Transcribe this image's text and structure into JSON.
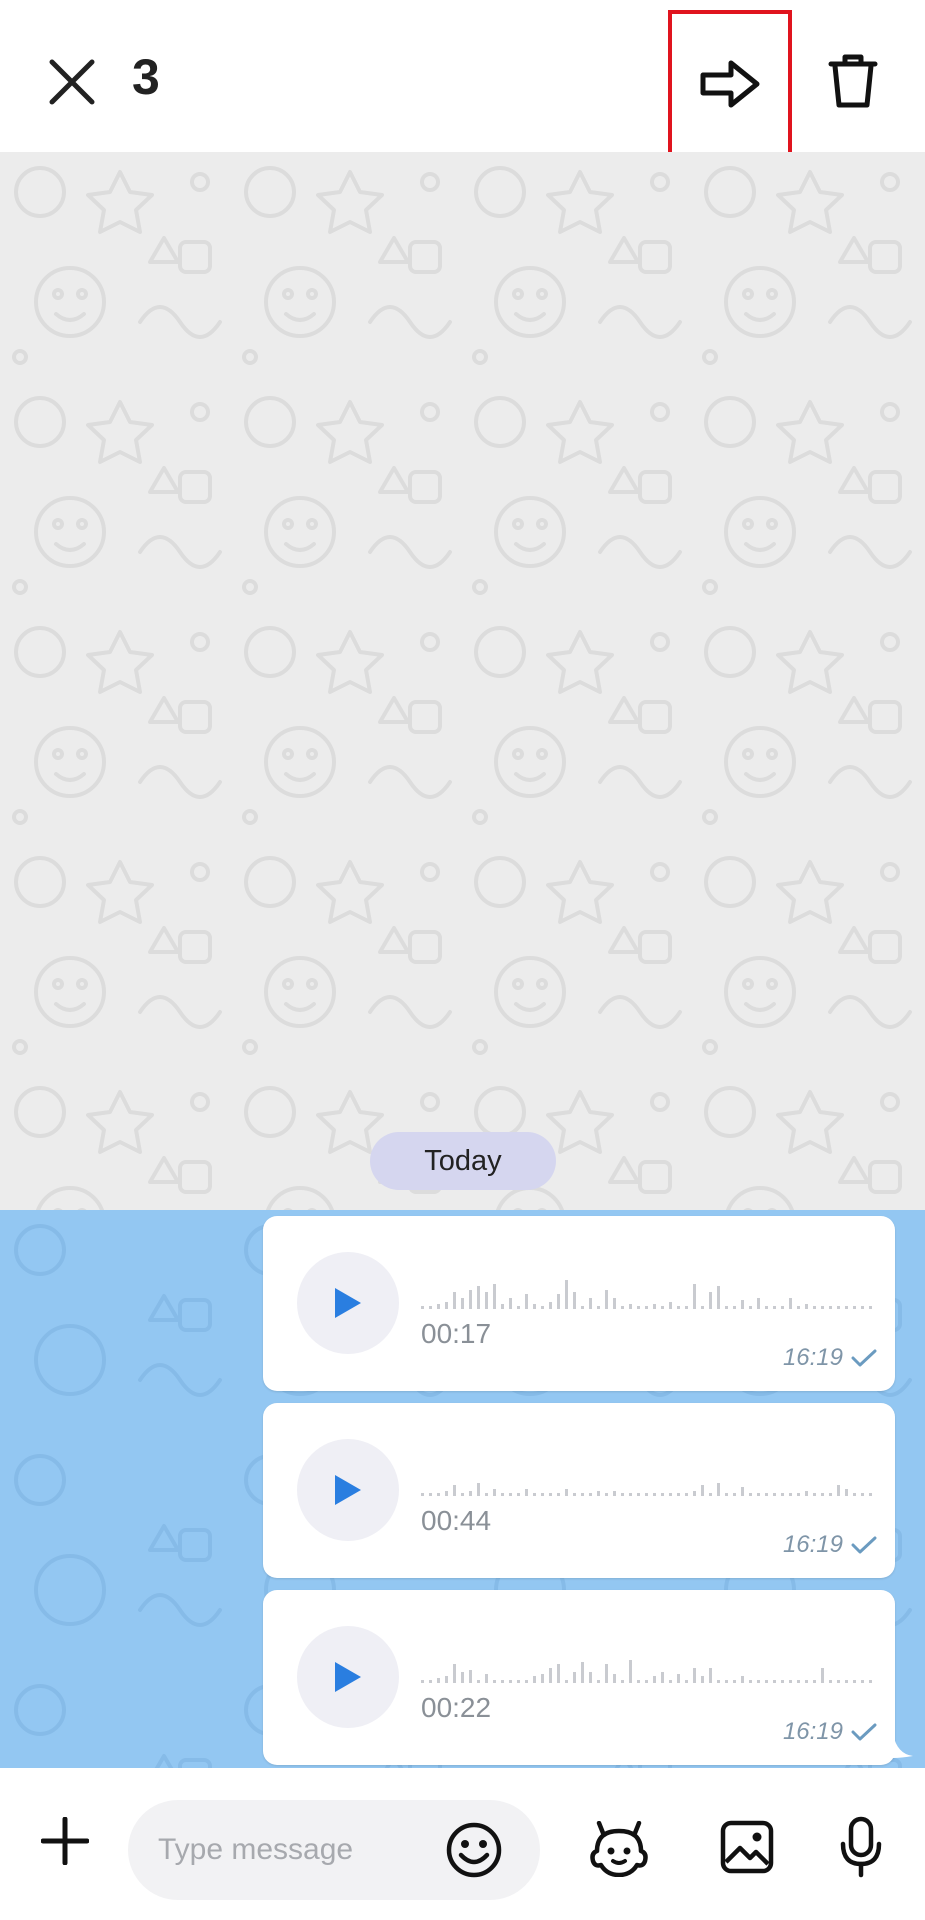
{
  "header": {
    "selected_count": "3",
    "close_icon": "close-icon",
    "forward_icon": "forward-arrow-icon",
    "delete_icon": "trash-icon",
    "highlight_color": "#e0141e"
  },
  "chat": {
    "date_separator": "Today",
    "selection_color": "#93c7f2",
    "messages": [
      {
        "type": "voice",
        "duration": "00:17",
        "time": "16:19",
        "status_icon": "check-icon"
      },
      {
        "type": "voice",
        "duration": "00:44",
        "time": "16:19",
        "status_icon": "check-icon"
      },
      {
        "type": "voice",
        "duration": "00:22",
        "time": "16:19",
        "status_icon": "check-icon"
      }
    ],
    "accent_color": "#2a7ee0"
  },
  "composer": {
    "placeholder": "Type message",
    "value": "",
    "attach_icon": "plus-icon",
    "emoji_icon": "smiley-icon",
    "sticker_icon": "bot-face-icon",
    "gallery_icon": "image-icon",
    "mic_icon": "microphone-icon"
  }
}
